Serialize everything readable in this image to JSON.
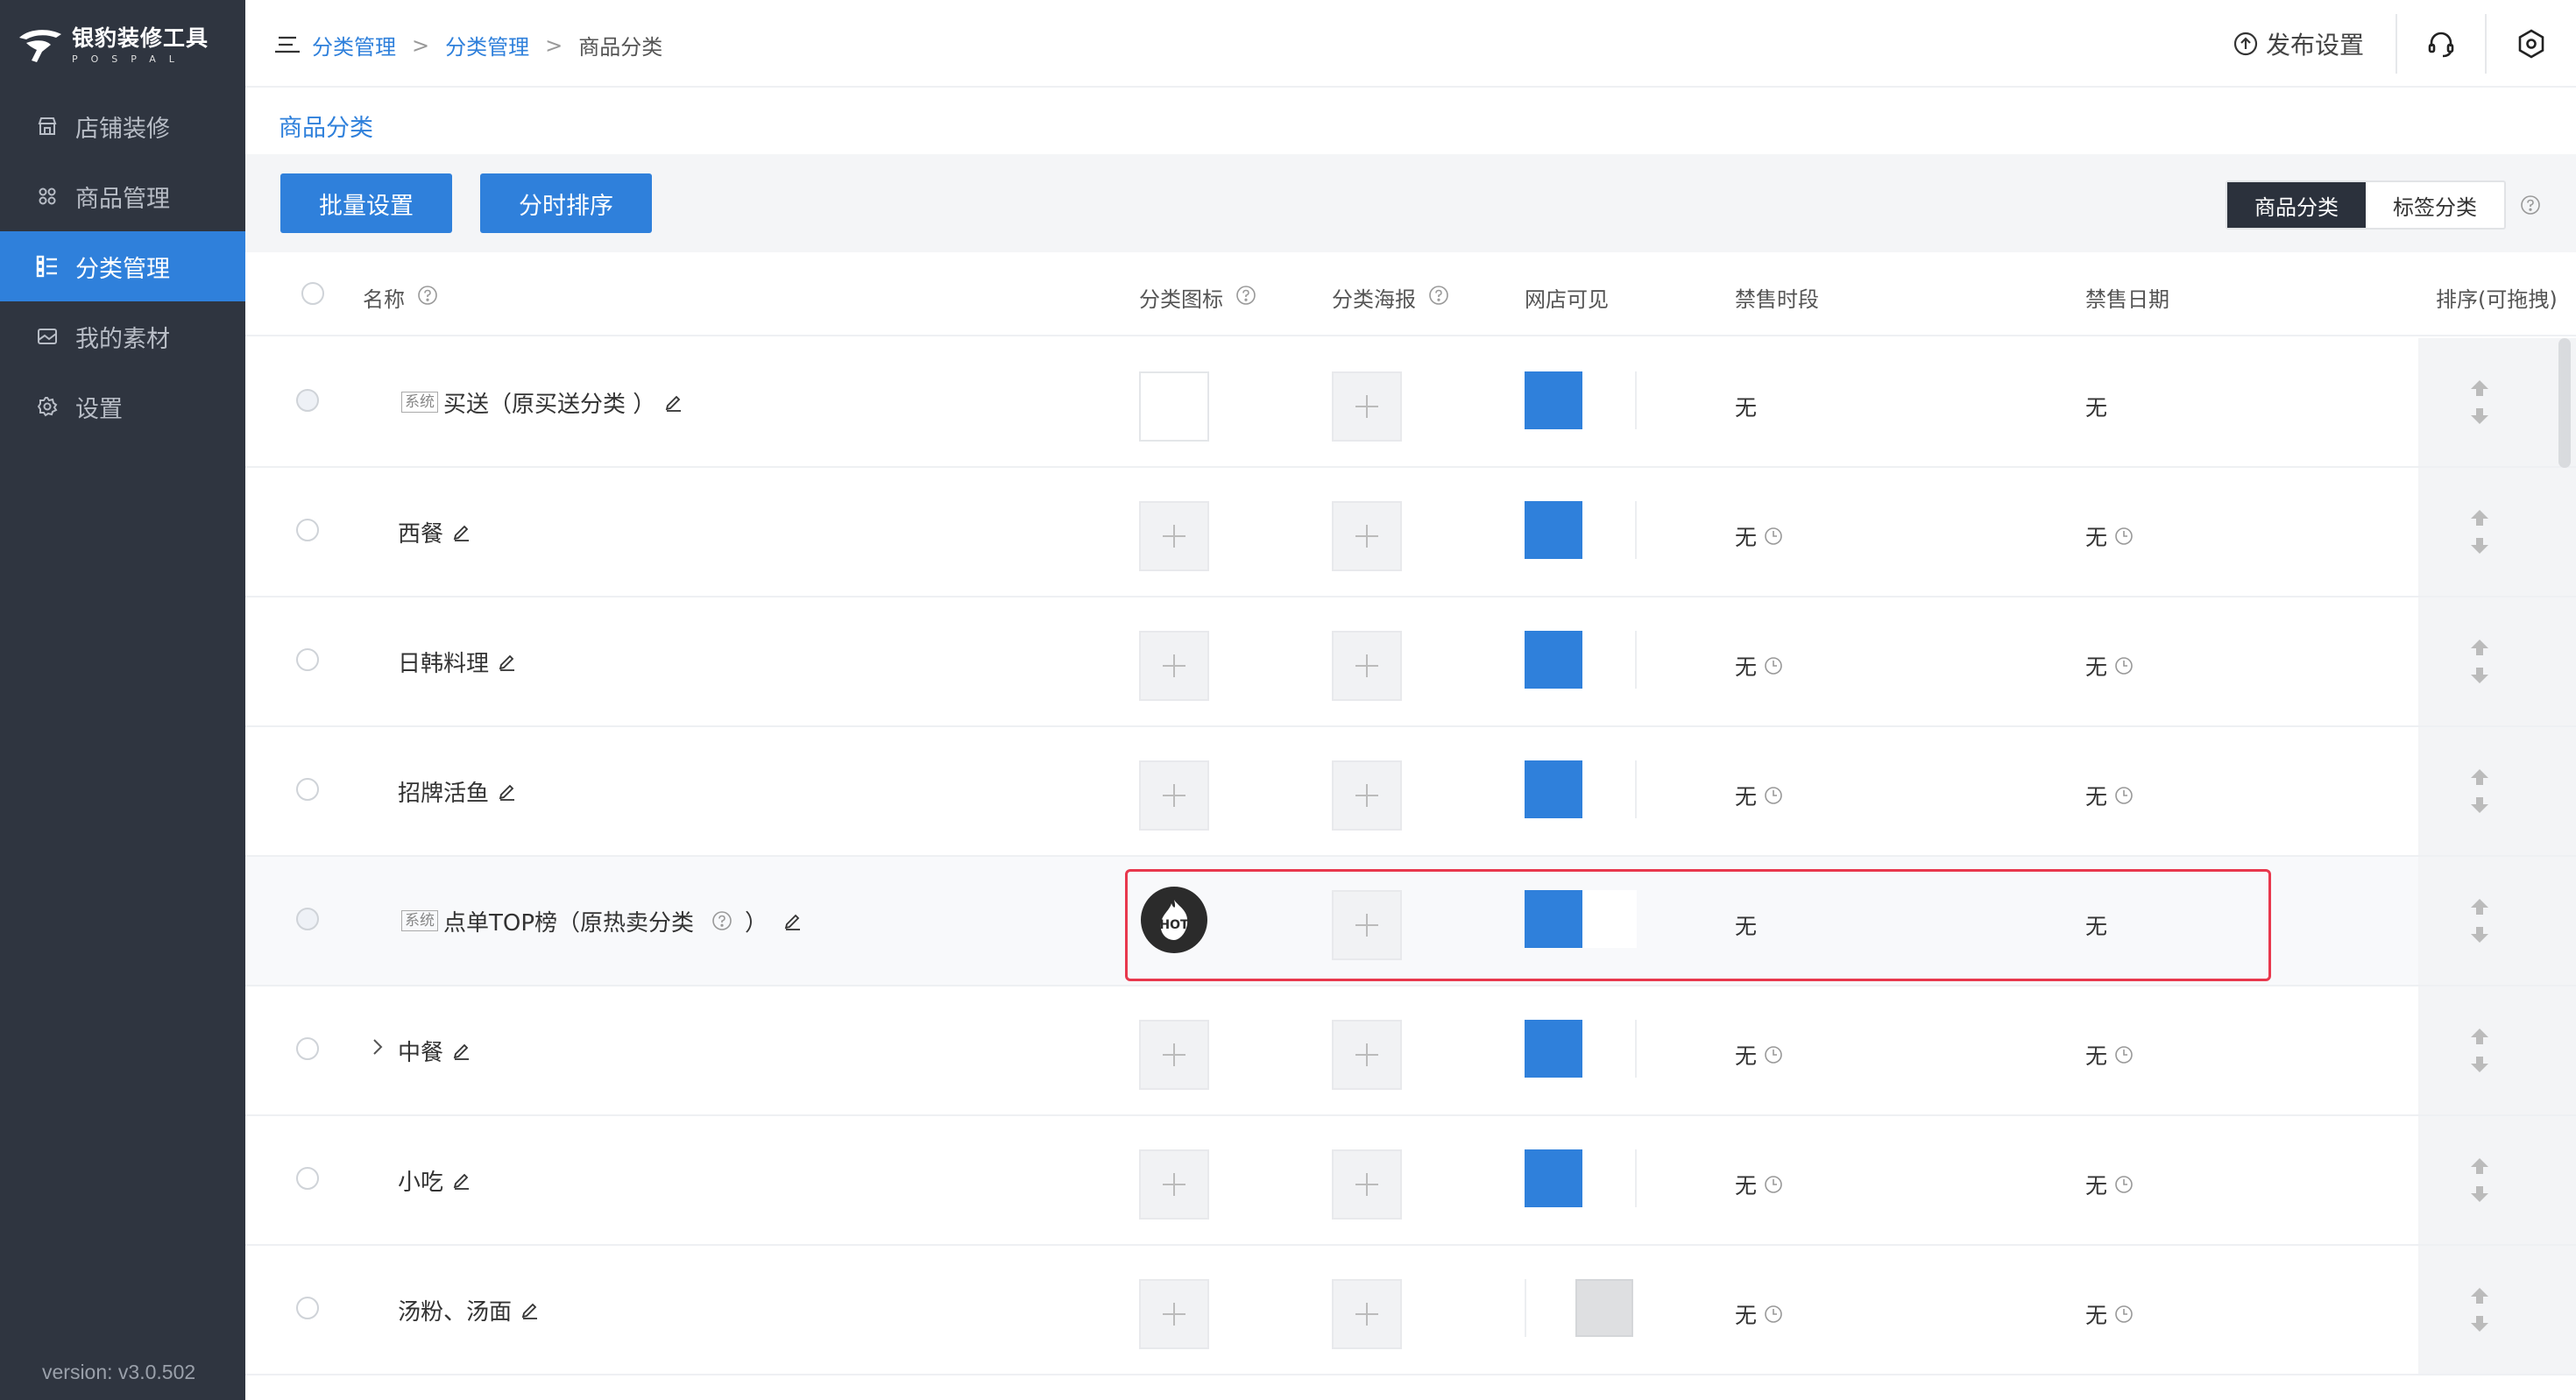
{
  "app": {
    "title": "银豹装修工具",
    "subtitle": "POSPAL",
    "version": "version: v3.0.502"
  },
  "sidebar": {
    "items": [
      {
        "label": "店铺装修",
        "icon": "store-icon",
        "active": false
      },
      {
        "label": "商品管理",
        "icon": "grid-icon",
        "active": false
      },
      {
        "label": "分类管理",
        "icon": "list-icon",
        "active": true
      },
      {
        "label": "我的素材",
        "icon": "image-icon",
        "active": false
      },
      {
        "label": "设置",
        "icon": "gear-icon",
        "active": false
      }
    ]
  },
  "header": {
    "breadcrumb": [
      "分类管理",
      "分类管理",
      "商品分类"
    ],
    "separator": ">",
    "publish_label": "发布设置"
  },
  "page": {
    "title": "商品分类",
    "batch_button": "批量设置",
    "timesort_button": "分时排序",
    "seg": [
      "商品分类",
      "标签分类"
    ]
  },
  "table": {
    "headers": {
      "name": "名称",
      "icon": "分类图标",
      "poster": "分类海报",
      "visible": "网店可见",
      "time": "禁售时段",
      "date": "禁售日期",
      "sort": "排序(可拖拽)"
    },
    "rows": [
      {
        "system": true,
        "sys_tag": "系统",
        "name": "买送（原买送分类 ）",
        "icon": "empty",
        "poster": "add",
        "visible": true,
        "time": "无",
        "date": "无",
        "clock": false
      },
      {
        "system": false,
        "name": "西餐",
        "icon": "add",
        "poster": "add",
        "visible": true,
        "time": "无",
        "date": "无",
        "clock": true
      },
      {
        "system": false,
        "name": "日韩料理",
        "icon": "add",
        "poster": "add",
        "visible": true,
        "time": "无",
        "date": "无",
        "clock": true
      },
      {
        "system": false,
        "name": "招牌活鱼",
        "icon": "add",
        "poster": "add",
        "visible": true,
        "time": "无",
        "date": "无",
        "clock": true
      },
      {
        "system": true,
        "sys_tag": "系统",
        "name": "点单TOP榜（原热卖分类",
        "name_suffix": "）",
        "icon": "hot",
        "hot_label": "HOT",
        "poster": "add",
        "visible": true,
        "time": "无",
        "date": "无",
        "clock": false,
        "highlighted": true
      },
      {
        "system": false,
        "name": "中餐",
        "expandable": true,
        "icon": "add",
        "poster": "add",
        "visible": true,
        "time": "无",
        "date": "无",
        "clock": true
      },
      {
        "system": false,
        "name": "小吃",
        "icon": "add",
        "poster": "add",
        "visible": true,
        "time": "无",
        "date": "无",
        "clock": true
      },
      {
        "system": false,
        "name": "汤粉、汤面",
        "icon": "add",
        "poster": "add",
        "visible": false,
        "time": "无",
        "date": "无",
        "clock": true
      }
    ]
  },
  "colors": {
    "sidebar_bg": "#2f3540",
    "accent": "#2f80db",
    "highlight": "#e8384d"
  }
}
